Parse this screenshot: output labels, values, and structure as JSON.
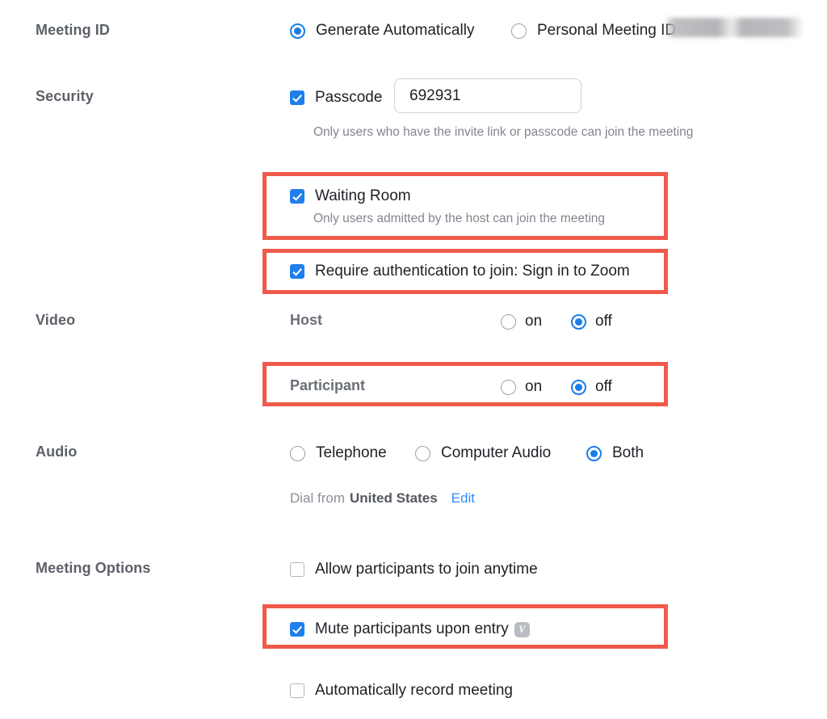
{
  "colors": {
    "highlight_red": "#f05a4b",
    "accent_blue": "#1f7fec",
    "link_blue": "#2d8cff",
    "label_gray": "#5c6169",
    "helper_gray": "#82868e"
  },
  "sections": {
    "meeting_id": {
      "label": "Meeting ID",
      "options": [
        {
          "label": "Generate Automatically",
          "selected": true
        },
        {
          "label": "Personal Meeting ID",
          "selected": false,
          "value_redacted": true
        }
      ]
    },
    "security": {
      "label": "Security",
      "passcode": {
        "label": "Passcode",
        "checked": true,
        "value": "692931",
        "placeholder": "Passcode"
      },
      "passcode_helper": "Only users who have the invite link or passcode can join the meeting",
      "waiting_room": {
        "label": "Waiting Room",
        "checked": true,
        "helper": "Only users admitted by the host can join the meeting",
        "highlighted": true
      },
      "require_auth": {
        "label": "Require authentication to join: Sign in to Zoom",
        "checked": true,
        "highlighted": true
      }
    },
    "video": {
      "label": "Video",
      "rows": [
        {
          "name": "Host",
          "on_label": "on",
          "off_label": "off",
          "selected": "off",
          "highlighted": false
        },
        {
          "name": "Participant",
          "on_label": "on",
          "off_label": "off",
          "selected": "off",
          "highlighted": true
        }
      ]
    },
    "audio": {
      "label": "Audio",
      "options": [
        {
          "label": "Telephone",
          "selected": false
        },
        {
          "label": "Computer Audio",
          "selected": false
        },
        {
          "label": "Both",
          "selected": true
        }
      ],
      "dial_prefix": "Dial from",
      "dial_country": "United States",
      "edit_label": "Edit"
    },
    "meeting_options": {
      "label": "Meeting Options",
      "items": [
        {
          "label": "Allow participants to join anytime",
          "checked": false,
          "highlighted": false,
          "badge": null
        },
        {
          "label": "Mute participants upon entry",
          "checked": true,
          "highlighted": true,
          "badge": "info-badge-icon",
          "badge_glyph": "V"
        },
        {
          "label": "Automatically record meeting",
          "checked": false,
          "highlighted": false,
          "badge": null
        }
      ]
    }
  }
}
